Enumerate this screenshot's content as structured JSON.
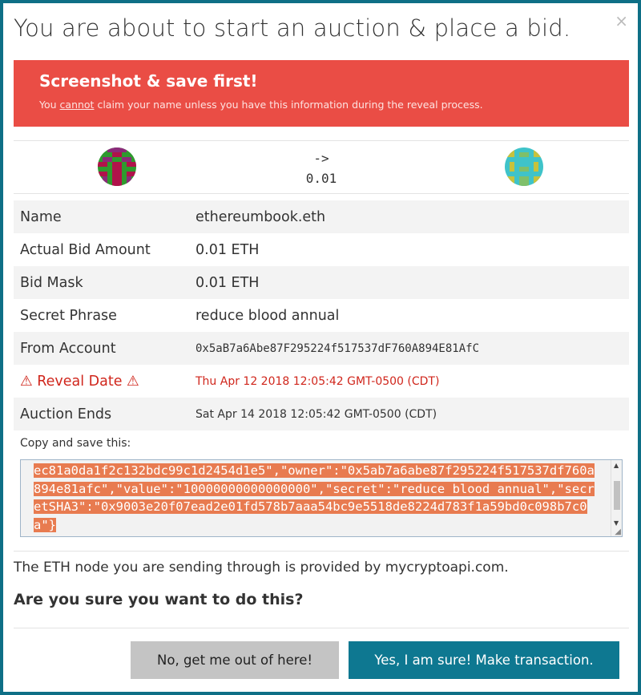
{
  "modal": {
    "title": "You are about to start an auction & place a bid.",
    "close_glyph": "×"
  },
  "alert": {
    "title": "Screenshot & save first!",
    "body_before": "You ",
    "body_emph": "cannot",
    "body_after": " claim your name unless you have this information during the reveal process."
  },
  "transfer": {
    "arrow": "->",
    "amount": "0.01"
  },
  "details": [
    {
      "label": "Name",
      "value": "ethereumbook.eth"
    },
    {
      "label": "Actual Bid Amount",
      "value": "0.01 ETH"
    },
    {
      "label": "Bid Mask",
      "value": "0.01 ETH"
    },
    {
      "label": "Secret Phrase",
      "value": "reduce blood annual"
    },
    {
      "label": "From Account",
      "value": "0x5aB7a6Abe87F295224f517537dF760A894E81AfC"
    },
    {
      "label": "⚠ Reveal Date ⚠",
      "value": "Thu Apr 12 2018 12:05:42 GMT-0500 (CDT)"
    },
    {
      "label": "Auction Ends",
      "value": "Sat Apr 14 2018 12:05:42 GMT-0500 (CDT)"
    }
  ],
  "copy": {
    "label": "Copy and save this:",
    "json": "ec81a0da1f2c132bdc99c1d2454d1e5\",\"owner\":\"0x5ab7a6abe87f295224f517537df760a894e81afc\",\"value\":\"10000000000000000\",\"secret\":\"reduce blood annual\",\"secretSHA3\":\"0x9003e20f07ead2e01fd578b7aaa54bc9e5518de8224d783f1a59bd0c098b7c0a\"}"
  },
  "footer": {
    "node_info": "The ETH node you are sending through is provided by mycryptoapi.com.",
    "question": "Are you sure you want to do this?",
    "cancel_label": "No, get me out of here!",
    "confirm_label": "Yes, I am sure! Make transaction."
  },
  "colors": {
    "accent": "#0e7891",
    "alert": "#ea4d45",
    "warning_text": "#d0261c",
    "selection": "#e87b50"
  },
  "icons": {
    "from_identicon": "identicon-from",
    "to_identicon": "identicon-to",
    "close": "close-icon"
  }
}
